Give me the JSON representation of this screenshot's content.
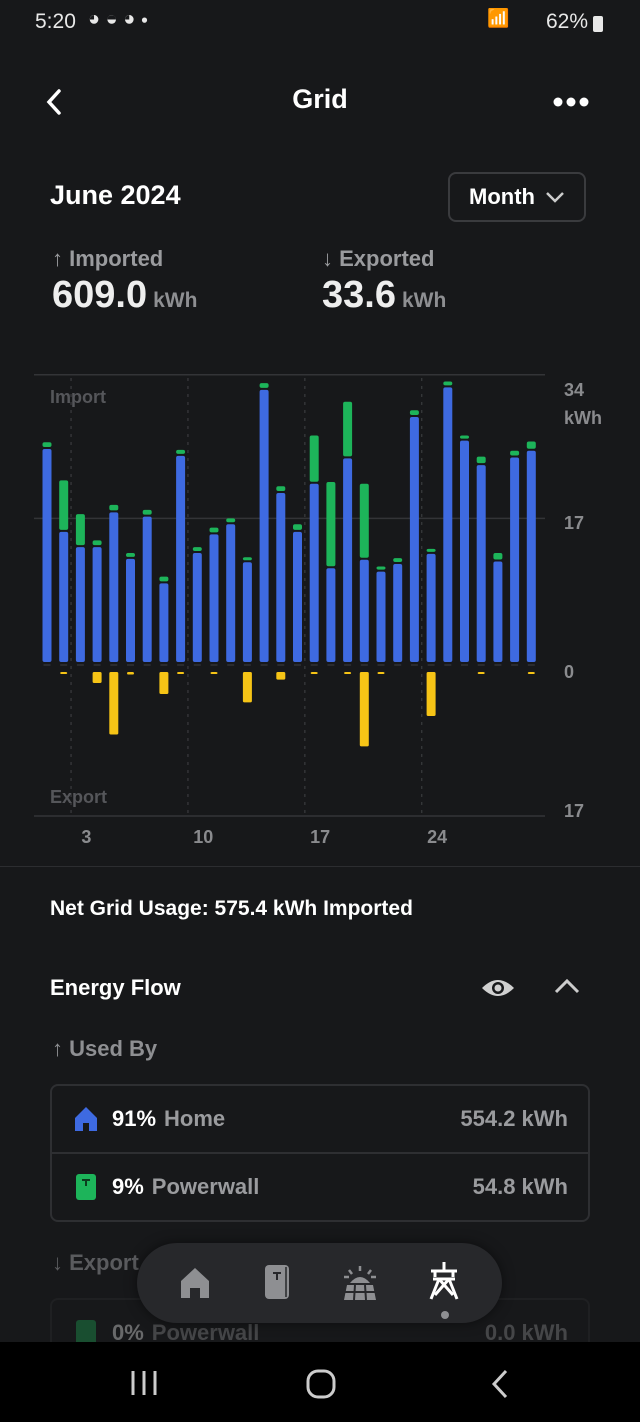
{
  "status_bar": {
    "time": "5:20",
    "battery": "62%"
  },
  "header": {
    "title": "Grid"
  },
  "period": {
    "label": "June 2024",
    "range_select": "Month"
  },
  "stats": {
    "imported": {
      "label": "Imported",
      "value": "609.0",
      "unit": "kWh"
    },
    "exported": {
      "label": "Exported",
      "value": "33.6",
      "unit": "kWh"
    }
  },
  "chart_data": {
    "type": "bar",
    "stacked": true,
    "top_label": "Import",
    "bottom_label": "Export",
    "unit": "kWh",
    "y_ticks_import": [
      "34",
      "17",
      "0"
    ],
    "y_tick_export": "17",
    "ylim_import": [
      0,
      34
    ],
    "ylim_export": [
      0,
      17
    ],
    "x_tick_labels": [
      {
        "day": 3,
        "label": "3"
      },
      {
        "day": 10,
        "label": "10"
      },
      {
        "day": 17,
        "label": "17"
      },
      {
        "day": 24,
        "label": "24"
      }
    ],
    "days": [
      1,
      2,
      3,
      4,
      5,
      6,
      7,
      8,
      9,
      10,
      11,
      12,
      13,
      14,
      15,
      16,
      17,
      18,
      19,
      20,
      21,
      22,
      23,
      24,
      25,
      26,
      27,
      28,
      29,
      30
    ],
    "series": [
      {
        "key": "home",
        "color": "#3e6ae1",
        "values": [
          25.2,
          15.4,
          13.6,
          13.6,
          17.7,
          12.2,
          17.2,
          9.3,
          24.4,
          12.9,
          15.1,
          16.3,
          11.8,
          32.2,
          20.0,
          15.4,
          21.1,
          11.1,
          24.1,
          12.1,
          10.7,
          11.6,
          29.0,
          12.8,
          32.5,
          26.2,
          23.3,
          11.9,
          24.2,
          25.0
        ]
      },
      {
        "key": "powerwall",
        "color": "#1db45a",
        "values": [
          0.8,
          6.1,
          3.9,
          0.8,
          0.9,
          0.7,
          0.8,
          0.8,
          0.7,
          0.7,
          0.8,
          0.7,
          0.6,
          0.8,
          0.8,
          0.9,
          5.7,
          10.2,
          6.7,
          9.0,
          0.6,
          0.7,
          0.8,
          0.4,
          0.7,
          0.6,
          1.0,
          1.0,
          0.8,
          1.1
        ]
      },
      {
        "key": "export",
        "color": "#f6c416",
        "values": [
          0,
          0.2,
          0,
          1.3,
          7.4,
          0.3,
          0,
          2.6,
          0.2,
          0,
          0.2,
          0,
          3.6,
          0,
          0.9,
          0,
          0.2,
          0,
          0.2,
          8.8,
          0.2,
          0,
          0,
          5.2,
          0,
          0,
          0.2,
          0,
          0,
          0.2
        ]
      }
    ],
    "grid": true
  },
  "net_usage": "Net Grid Usage: 575.4 kWh Imported",
  "energy_flow": {
    "title": "Energy Flow",
    "used_by_label": "Used By",
    "used_by": [
      {
        "icon": "home-icon",
        "pct": "91%",
        "name": "Home",
        "value": "554.2 kWh",
        "color": "#3e6ae1"
      },
      {
        "icon": "powerwall-icon",
        "pct": "9%",
        "name": "Powerwall",
        "value": "54.8 kWh",
        "color": "#1db45a"
      }
    ],
    "export_label": "Export",
    "export_to": [
      {
        "icon": "powerwall-icon",
        "pct": "0%",
        "name": "Powerwall",
        "value": "0.0 kWh"
      }
    ]
  },
  "bottom_nav": [
    {
      "icon": "home-icon"
    },
    {
      "icon": "powerwall-icon"
    },
    {
      "icon": "solar-icon"
    },
    {
      "icon": "grid-tower-icon",
      "active": true
    }
  ]
}
